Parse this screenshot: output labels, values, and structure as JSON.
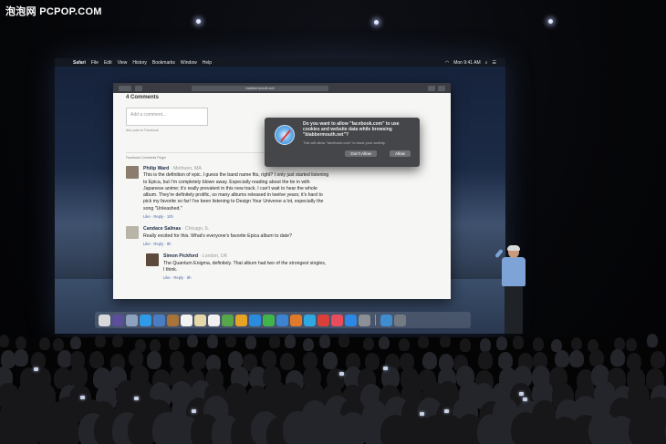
{
  "watermark": "泡泡网 PCPOP.COM",
  "menubar": {
    "app": "Safari",
    "items": [
      "File",
      "Edit",
      "View",
      "History",
      "Bookmarks",
      "Window",
      "Help"
    ],
    "clock": "Mon 9:41 AM"
  },
  "browser": {
    "url": "blabbermouth.net"
  },
  "page": {
    "comment_count": "4 Comments",
    "add_comment_placeholder": "Add a comment...",
    "post_to_facebook": "Also post on Facebook",
    "plugin_label": "Facebook Comments Plugin",
    "comments": [
      {
        "name": "Philip Ward",
        "location": "Methuen, MA",
        "text": "This is the definition of epic. I guess the band name fits, right? I only just started listening to Epica, but I'm completely blown away. Especially reading about the tie in with Japanese anime; it's really prevalent in this new track. I can't wait to hear the whole album. They're definitely prolific, so many albums released in twelve years; it's hard to pick my favorite so far! I've been listening to Design Your Universe a lot, especially the song \"Unleashed.\"",
        "actions": "Like · Reply · 10h"
      },
      {
        "name": "Candace Salinas",
        "location": "Chicago, IL",
        "text": "Really excited for this. What's everyone's favorite Epica album to date?",
        "actions": "Like · Reply · 8h"
      },
      {
        "name": "Simon Pickford",
        "location": "London, UK",
        "text": "The Quantum Enigma, definitely. That album had two of the strongest singles, I think.",
        "actions": "Like · Reply · 8h"
      }
    ]
  },
  "dialog": {
    "title": "Do you want to allow \"facebook.com\" to use cookies and website data while browsing \"blabbermouth.net\"?",
    "subtitle": "This will allow \"facebook.com\" to track your activity.",
    "deny_label": "Don't Allow",
    "allow_label": "Allow"
  },
  "colors": {
    "dock_icons": [
      "#d9d9db",
      "#5b4f99",
      "#8ea2c0",
      "#2f9ae8",
      "#4a7ec4",
      "#a8743a",
      "#f2f2f2",
      "#e6d7a8",
      "#f0f0f0",
      "#58a64a",
      "#e7a325",
      "#2b8cde",
      "#3fb54b",
      "#3c84d2",
      "#e07a2b",
      "#2fa7e0",
      "#d9403a",
      "#e94d5d",
      "#2d87e4",
      "#8b8f96",
      "#3f8ccf",
      "#747a82"
    ]
  }
}
